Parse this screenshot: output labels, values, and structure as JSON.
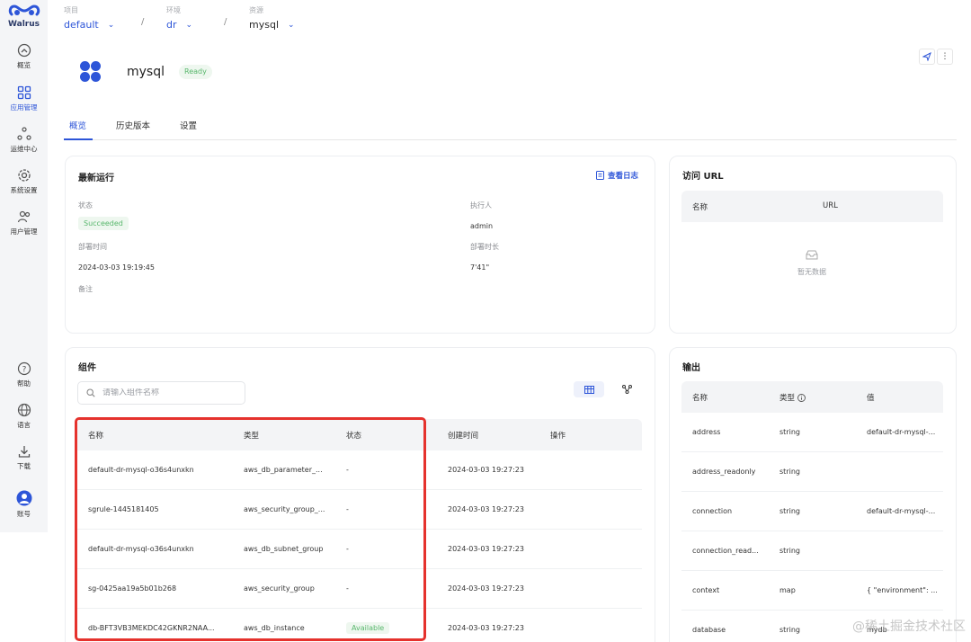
{
  "sidebar": {
    "logo": "Walrus",
    "items": [
      {
        "label": "概览",
        "icon": "dashboard-icon"
      },
      {
        "label": "应用管理",
        "icon": "grid-icon",
        "active": true
      },
      {
        "label": "运维中心",
        "icon": "ops-icon"
      },
      {
        "label": "系统设置",
        "icon": "gear-icon"
      },
      {
        "label": "用户管理",
        "icon": "users-icon"
      }
    ],
    "bottom_items": [
      {
        "label": "帮助",
        "icon": "help-icon"
      },
      {
        "label": "语言",
        "icon": "globe-icon"
      },
      {
        "label": "下载",
        "icon": "download-icon"
      },
      {
        "label": "账号",
        "icon": "account-icon"
      }
    ]
  },
  "breadcrumb": [
    {
      "label": "项目",
      "value": "default"
    },
    {
      "label": "环境",
      "value": "dr"
    },
    {
      "label": "资源",
      "value": "mysql"
    }
  ],
  "header": {
    "title": "mysql",
    "status": "Ready"
  },
  "tabs": [
    "概览",
    "历史版本",
    "设置"
  ],
  "latest_run": {
    "title": "最新运行",
    "log_link": "查看日志",
    "status_label": "状态",
    "status_value": "Succeeded",
    "executor_label": "执行人",
    "executor_value": "admin",
    "deploy_time_label": "部署时间",
    "deploy_time_value": "2024-03-03 19:19:45",
    "duration_label": "部署时长",
    "duration_value": "7'41\"",
    "note_label": "备注"
  },
  "access_url": {
    "title": "访问 URL",
    "columns": [
      "名称",
      "URL"
    ],
    "empty_text": "暂无数据"
  },
  "components": {
    "title": "组件",
    "search_placeholder": "请输入组件名称",
    "columns": [
      "名称",
      "类型",
      "状态",
      "创建时间",
      "操作"
    ],
    "rows": [
      {
        "name": "default-dr-mysql-o36s4unxkn",
        "type": "aws_db_parameter_...",
        "status": "-",
        "created": "2024-03-03 19:27:23"
      },
      {
        "name": "sgrule-1445181405",
        "type": "aws_security_group_...",
        "status": "-",
        "created": "2024-03-03 19:27:23"
      },
      {
        "name": "default-dr-mysql-o36s4unxkn",
        "type": "aws_db_subnet_group",
        "status": "-",
        "created": "2024-03-03 19:27:23"
      },
      {
        "name": "sg-0425aa19a5b01b268",
        "type": "aws_security_group",
        "status": "-",
        "created": "2024-03-03 19:27:23"
      },
      {
        "name": "db-BFT3VB3MEKDC42GKNR2NAA...",
        "type": "aws_db_instance",
        "status": "Available",
        "created": "2024-03-03 19:27:23"
      }
    ]
  },
  "outputs": {
    "title": "输出",
    "columns": [
      "名称",
      "类型",
      "值"
    ],
    "rows": [
      {
        "name": "address",
        "type": "string",
        "value": "default-dr-mysql-..."
      },
      {
        "name": "address_readonly",
        "type": "string",
        "value": ""
      },
      {
        "name": "connection",
        "type": "string",
        "value": "default-dr-mysql-..."
      },
      {
        "name": "connection_read...",
        "type": "string",
        "value": ""
      },
      {
        "name": "context",
        "type": "map",
        "value": "{ \"environment\": ..."
      },
      {
        "name": "database",
        "type": "string",
        "value": "mydb"
      }
    ]
  },
  "watermark": "@稀土掘金技术社区",
  "colors": {
    "accent": "#2d55d8",
    "success": "#58b76c",
    "highlight": "#e5322d"
  }
}
